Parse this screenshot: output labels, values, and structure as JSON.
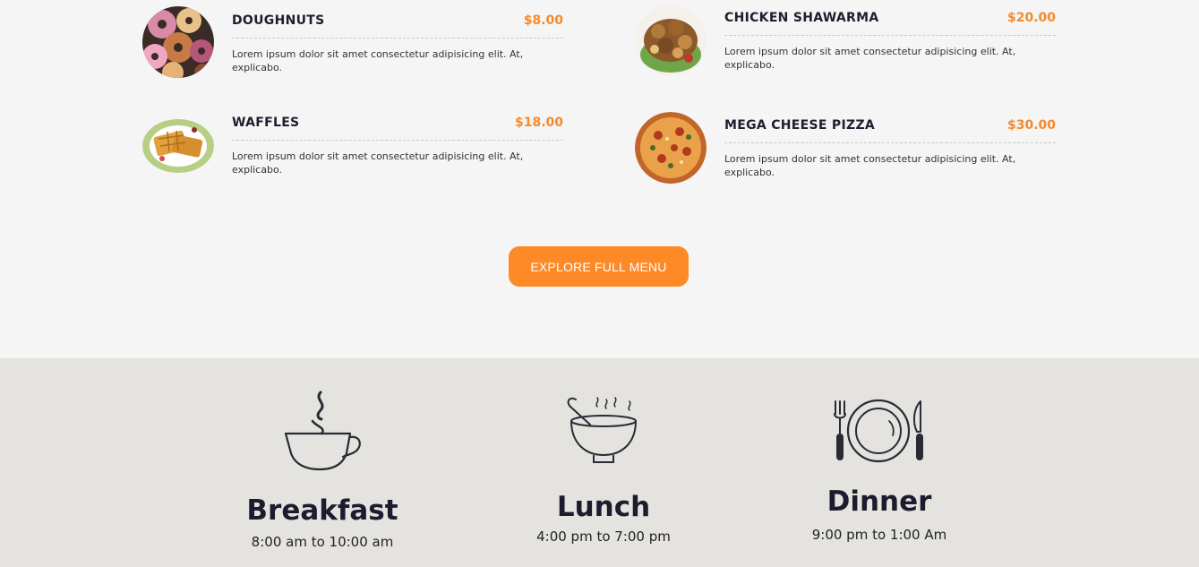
{
  "menu": {
    "items": [
      {
        "name": "DOUGHNUTS",
        "price": "$8.00",
        "description": "Lorem ipsum dolor sit amet consectetur adipisicing elit. At, explicabo.",
        "image_icon": "doughnuts-image"
      },
      {
        "name": "CHICKEN SHAWARMA",
        "price": "$20.00",
        "description": "Lorem ipsum dolor sit amet consectetur adipisicing elit. At, explicabo.",
        "image_icon": "chicken-shawarma-image"
      },
      {
        "name": "WAFFLES",
        "price": "$18.00",
        "description": "Lorem ipsum dolor sit amet consectetur adipisicing elit. At, explicabo.",
        "image_icon": "waffles-image"
      },
      {
        "name": "MEGA CHEESE PIZZA",
        "price": "$30.00",
        "description": "Lorem ipsum dolor sit amet consectetur adipisicing elit. At, explicabo.",
        "image_icon": "pizza-image"
      }
    ],
    "explore_label": "EXPLORE FULL MENU"
  },
  "hours": {
    "meals": [
      {
        "title": "Breakfast",
        "time": "8:00 am to 10:00 am",
        "icon": "coffee-cup-icon"
      },
      {
        "title": "Lunch",
        "time": "4:00 pm to 7:00 pm",
        "icon": "soup-bowl-icon"
      },
      {
        "title": "Dinner",
        "time": "9:00 pm to 1:00 Am",
        "icon": "plate-cutlery-icon"
      }
    ]
  },
  "colors": {
    "accent": "#fd8a27",
    "price": "#f68a2a",
    "page_background": "#f5f5f5",
    "hours_background": "#e5e3e0",
    "heading": "#1e1e2f"
  }
}
